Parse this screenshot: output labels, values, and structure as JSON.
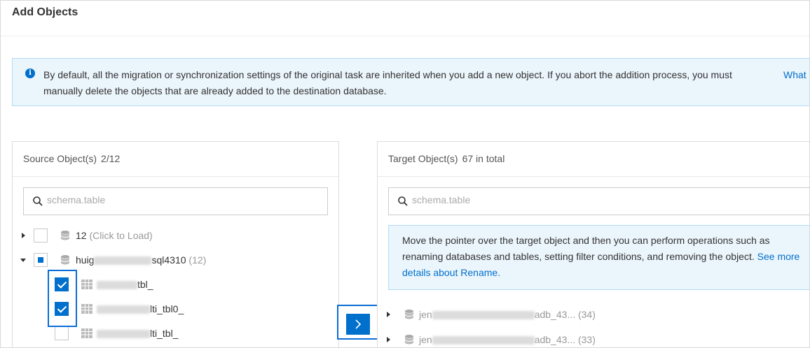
{
  "title": "Add Objects",
  "notice": {
    "icon": "info-icon",
    "text": "By default, all the migration or synchronization settings of the original task are inherited when you add a new object. If you abort the addition process, you must manually delete the objects that are already added to the destination database.",
    "link": "What"
  },
  "source": {
    "header_label": "Source Object(s)",
    "header_count": "2/12",
    "search_placeholder": "schema.table",
    "tree": [
      {
        "label": "12",
        "suffix": "(Click to Load)",
        "expanded": false,
        "checked": "none"
      },
      {
        "label_prefix": "huig",
        "label_suffix": "sql4310",
        "count": "(12)",
        "expanded": true,
        "checked": "partial"
      }
    ],
    "tables": [
      {
        "label_suffix": "tbl_",
        "checked": true
      },
      {
        "label_suffix": "lti_tbl0_",
        "checked": true
      },
      {
        "label_suffix": "lti_tbl_",
        "checked": false
      }
    ]
  },
  "transfer_button": {
    "icon": "chevron-right-icon"
  },
  "target": {
    "header_label": "Target Object(s)",
    "header_count": "67 in total",
    "search_placeholder": "schema.table",
    "notice_text": "Move the pointer over the target object and then you can perform operations such as renaming databases and tables, setting filter conditions, and removing the object.",
    "notice_link": "See more details about Rename.",
    "tree": [
      {
        "label_prefix": "jen",
        "label_suffix": "adb_43...",
        "count": "(34)"
      },
      {
        "label_prefix": "jen",
        "label_suffix": "adb_43...",
        "count": "(33)"
      }
    ]
  },
  "colors": {
    "accent": "#0070cc",
    "notice_bg": "#ebf5fc",
    "highlight": "#0b6cd6"
  }
}
